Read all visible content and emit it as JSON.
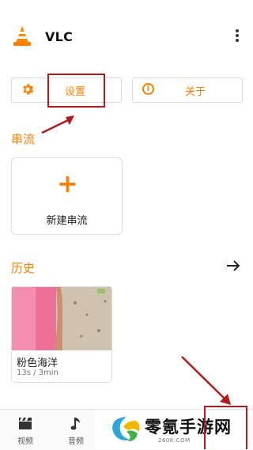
{
  "header": {
    "title": "VLC"
  },
  "actions": {
    "settings_label": "设置",
    "about_label": "关于"
  },
  "stream": {
    "section_title": "串流",
    "new_stream_label": "新建串流"
  },
  "history": {
    "section_title": "历史",
    "items": [
      {
        "title": "粉色海洋",
        "meta": "13s / 3min"
      }
    ]
  },
  "bottom_nav": {
    "items": [
      {
        "label": "视频",
        "icon": "film-clapper-icon"
      },
      {
        "label": "音频",
        "icon": "music-note-icon"
      }
    ]
  },
  "watermark": {
    "text": "零氪手游网",
    "sub": "260K.COM"
  },
  "colors": {
    "accent": "#ff7f00",
    "annotation": "#b01c1c"
  }
}
